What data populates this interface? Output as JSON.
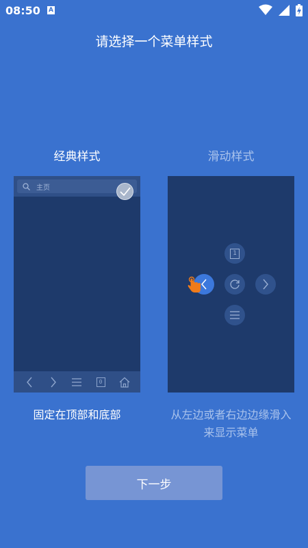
{
  "status_bar": {
    "time": "08:50",
    "notification_icon_letter": "A",
    "icons": [
      "wifi-icon",
      "signal-icon",
      "battery-charging-icon"
    ]
  },
  "page": {
    "title": "请选择一个菜单样式"
  },
  "options": {
    "classic": {
      "title": "经典样式",
      "search_placeholder": "主页",
      "tab_count": "0",
      "description": "固定在顶部和底部",
      "selected": true
    },
    "slide": {
      "title": "滑动样式",
      "tab_count": "1",
      "description": "从左边或者右边边缘滑入来显示菜单",
      "selected": false
    }
  },
  "next_button": {
    "label": "下一步"
  },
  "colors": {
    "background": "#3a72cf",
    "preview_background": "#1e3a6b",
    "bar": "#2f4f87",
    "button": "#7795d4",
    "muted_text": "#aac3ec",
    "active_control": "#3c78dc",
    "finger": "#f07b1a"
  }
}
